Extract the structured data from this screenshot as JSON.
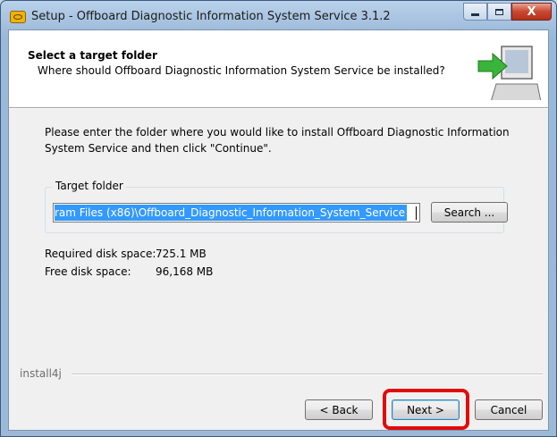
{
  "window": {
    "title": "Setup - Offboard Diagnostic Information System Service 3.1.2",
    "icon": "installer-app-icon",
    "caption_buttons": [
      "minimize-icon",
      "maximize-icon",
      "close-icon"
    ],
    "close_glyph": "X"
  },
  "header": {
    "title": "Select a target folder",
    "subtitle": "Where should Offboard Diagnostic Information System Service be installed?",
    "graphic": "computer-install-icon"
  },
  "body": {
    "intro": "Please enter the folder where you would like to install Offboard Diagnostic Information System Service and then click \"Continue\".",
    "target_group_label": "Target folder",
    "target_folder_value": "ram Files (x86)\\Offboard_Diagnostic_Information_System_Service",
    "search_button": "Search ...",
    "required_label": "Required disk space:",
    "required_value": "725.1 MB",
    "free_label": "Free disk space:",
    "free_value": "96,168 MB"
  },
  "footer": {
    "brand": "install4j",
    "back": "< Back",
    "next": "Next >",
    "cancel": "Cancel"
  },
  "colors": {
    "selection": "#3399ff",
    "highlight_box": "#e10b0b",
    "close_button": "#c9472f"
  }
}
